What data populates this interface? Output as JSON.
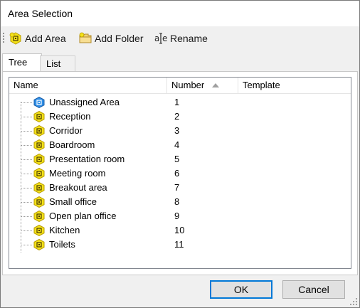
{
  "window": {
    "title": "Area Selection"
  },
  "toolbar": {
    "add_area": "Add Area",
    "add_folder": "Add Folder",
    "rename": "Rename"
  },
  "tabs": [
    {
      "label": "Tree",
      "active": true
    },
    {
      "label": "List",
      "active": false
    }
  ],
  "table": {
    "columns": [
      "Name",
      "Number",
      "Template"
    ],
    "sort_column": "Number",
    "sort_direction": "ascending",
    "rows": [
      {
        "name": "Unassigned Area",
        "number": "1",
        "icon": "unassigned-area-icon"
      },
      {
        "name": "Reception",
        "number": "2",
        "icon": "area-icon"
      },
      {
        "name": "Corridor",
        "number": "3",
        "icon": "area-icon"
      },
      {
        "name": "Boardroom",
        "number": "4",
        "icon": "area-icon"
      },
      {
        "name": "Presentation room",
        "number": "5",
        "icon": "area-icon"
      },
      {
        "name": "Meeting room",
        "number": "6",
        "icon": "area-icon"
      },
      {
        "name": "Breakout area",
        "number": "7",
        "icon": "area-icon"
      },
      {
        "name": "Small office",
        "number": "8",
        "icon": "area-icon"
      },
      {
        "name": "Open plan office",
        "number": "9",
        "icon": "area-icon"
      },
      {
        "name": "Kitchen",
        "number": "10",
        "icon": "area-icon"
      },
      {
        "name": "Toilets",
        "number": "11",
        "icon": "area-icon"
      }
    ]
  },
  "buttons": {
    "ok": "OK",
    "cancel": "Cancel"
  },
  "colors": {
    "area_icon_fill": "#f4e21a",
    "area_icon_outline": "#b89b00",
    "unassigned_icon_fill": "#2f8ee6",
    "default_button_border": "#0078d7"
  }
}
